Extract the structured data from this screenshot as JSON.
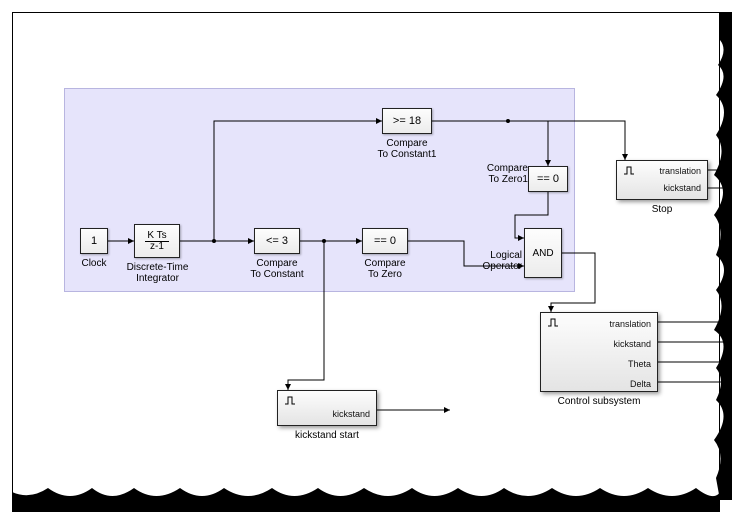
{
  "blocks": {
    "clock": {
      "content": "1",
      "label": "Clock"
    },
    "dti": {
      "num": "K Ts",
      "den": "z-1",
      "label": "Discrete-Time\nIntegrator"
    },
    "cmp_const": {
      "content": "<= 3",
      "label": "Compare\nTo Constant"
    },
    "cmp_zero": {
      "content": "== 0",
      "label": "Compare\nTo Zero"
    },
    "cmp_const1": {
      "content": ">= 18",
      "label": "Compare\nTo Constant1"
    },
    "cmp_zero1": {
      "content": "== 0",
      "label": "Compare\nTo Zero1"
    },
    "logic_op": {
      "content": "AND",
      "label": "Logical\nOperator"
    },
    "kickstand_start": {
      "label": "kickstand start",
      "port": "kickstand"
    },
    "stop": {
      "label": "Stop",
      "ports": [
        "translation",
        "kickstand"
      ]
    },
    "control": {
      "label": "Control subsystem",
      "ports": [
        "translation",
        "kickstand",
        "Theta",
        "Delta"
      ]
    }
  }
}
